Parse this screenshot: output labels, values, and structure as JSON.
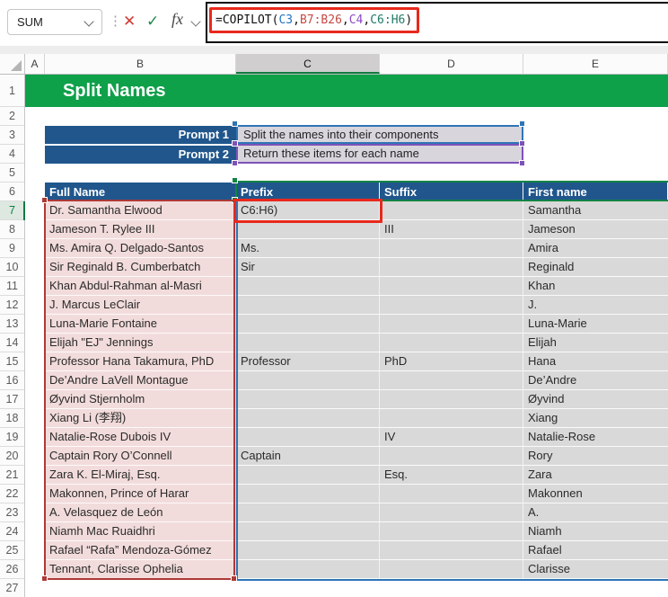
{
  "formula_bar": {
    "name_box_value": "SUM",
    "formula_parts": [
      {
        "text": "=COPILOT(",
        "color": "#111111"
      },
      {
        "text": "C3",
        "color": "#2173c8"
      },
      {
        "text": ",",
        "color": "#111111"
      },
      {
        "text": "B7:B26",
        "color": "#c64a42"
      },
      {
        "text": ",",
        "color": "#111111"
      },
      {
        "text": "C4",
        "color": "#8c48c4"
      },
      {
        "text": ",",
        "color": "#111111"
      },
      {
        "text": "C6:H6",
        "color": "#1e7b68"
      },
      {
        "text": ")",
        "color": "#111111"
      }
    ]
  },
  "column_headers": [
    "A",
    "B",
    "C",
    "D",
    "E"
  ],
  "selected_column": "C",
  "row_numbers": [
    1,
    2,
    3,
    4,
    5,
    6,
    7,
    8,
    9,
    10,
    11,
    12,
    13,
    14,
    15,
    16,
    17,
    18,
    19,
    20,
    21,
    22,
    23,
    24,
    25,
    26,
    27
  ],
  "active_row": 7,
  "sheet_title": "Split Names",
  "prompts": [
    {
      "label": "Prompt 1",
      "value": "Split the names into their components"
    },
    {
      "label": "Prompt 2",
      "value": "Return these items for each name"
    }
  ],
  "table": {
    "headers": [
      "Full Name",
      "Prefix",
      "Suffix",
      "First name"
    ],
    "rows": [
      {
        "row": 7,
        "full": "Dr. Samantha Elwood",
        "prefix": "C6:H6)",
        "suffix": "",
        "first": "Samantha",
        "editing": true
      },
      {
        "row": 8,
        "full": "Jameson T. Rylee III",
        "prefix": "",
        "suffix": "III",
        "first": "Jameson"
      },
      {
        "row": 9,
        "full": "Ms. Amira Q. Delgado-Santos",
        "prefix": "Ms.",
        "suffix": "",
        "first": "Amira"
      },
      {
        "row": 10,
        "full": "Sir Reginald B. Cumberbatch",
        "prefix": "Sir",
        "suffix": "",
        "first": "Reginald"
      },
      {
        "row": 11,
        "full": "Khan Abdul-Rahman al-Masri",
        "prefix": "",
        "suffix": "",
        "first": "Khan"
      },
      {
        "row": 12,
        "full": "J. Marcus LeClair",
        "prefix": "",
        "suffix": "",
        "first": "J."
      },
      {
        "row": 13,
        "full": "Luna-Marie Fontaine",
        "prefix": "",
        "suffix": "",
        "first": "Luna-Marie"
      },
      {
        "row": 14,
        "full": "Elijah \"EJ\" Jennings",
        "prefix": "",
        "suffix": "",
        "first": "Elijah"
      },
      {
        "row": 15,
        "full": "Professor Hana Takamura, PhD",
        "prefix": "Professor",
        "suffix": "PhD",
        "first": "Hana"
      },
      {
        "row": 16,
        "full": "De’Andre LaVell Montague",
        "prefix": "",
        "suffix": "",
        "first": "De’Andre"
      },
      {
        "row": 17,
        "full": "Øyvind Stjernholm",
        "prefix": "",
        "suffix": "",
        "first": "Øyvind"
      },
      {
        "row": 18,
        "full": "Xiang Li (李翔)",
        "prefix": "",
        "suffix": "",
        "first": "Xiang"
      },
      {
        "row": 19,
        "full": "Natalie-Rose Dubois IV",
        "prefix": "",
        "suffix": "IV",
        "first": "Natalie-Rose"
      },
      {
        "row": 20,
        "full": "Captain Rory O’Connell",
        "prefix": "Captain",
        "suffix": "",
        "first": "Rory"
      },
      {
        "row": 21,
        "full": "Zara K. El-Miraj, Esq.",
        "prefix": "",
        "suffix": "Esq.",
        "first": "Zara"
      },
      {
        "row": 22,
        "full": "Makonnen, Prince of Harar",
        "prefix": "",
        "suffix": "",
        "first": "Makonnen"
      },
      {
        "row": 23,
        "full": "A. Velasquez de León",
        "prefix": "",
        "suffix": "",
        "first": "A."
      },
      {
        "row": 24,
        "full": "Niamh Mac Ruaidhri",
        "prefix": "",
        "suffix": "",
        "first": "Niamh"
      },
      {
        "row": 25,
        "full": "Rafael “Rafa” Mendoza-Gómez",
        "prefix": "",
        "suffix": "",
        "first": "Rafael"
      },
      {
        "row": 26,
        "full": "Tennant, Clarisse Ophelia",
        "prefix": "",
        "suffix": "",
        "first": "Clarisse"
      }
    ]
  },
  "colors": {
    "accent_green": "#0fa04a",
    "sel_green": "#107c41",
    "range_green": "#128445",
    "header_blue": "#20568c",
    "pink_fill": "#f2dcdb",
    "gray_fill": "#d9d9d9",
    "prompt_fill": "#d8d5dd",
    "range_red": "#ad3a38",
    "annotation_red": "#e8291d",
    "spill_blue": "#2e75b6",
    "sel_purple": "#7d52b8"
  }
}
